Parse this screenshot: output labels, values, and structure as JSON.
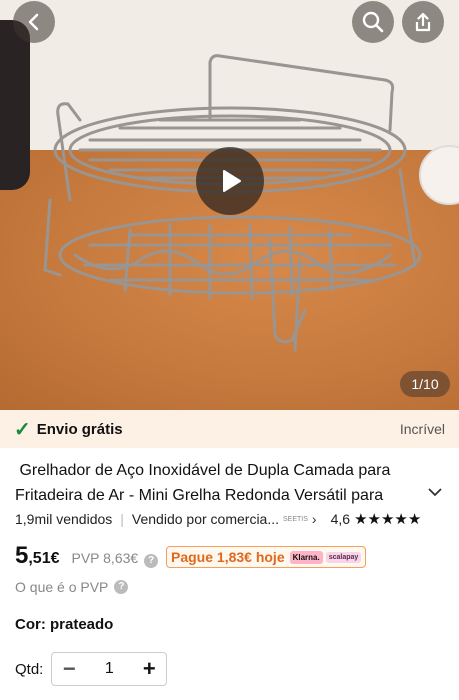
{
  "header": {
    "back_icon": "chevron-left-icon",
    "search_icon": "search-icon",
    "share_icon": "share-icon"
  },
  "gallery": {
    "counter": "1/10",
    "play_icon": "play-icon"
  },
  "shipping": {
    "label": "Envio grátis",
    "badge": "Incrível",
    "color": "#1a8a3c"
  },
  "product": {
    "title": "Grelhador de Aço Inoxidável de Dupla Camada para Fritadeira de Ar - Mini Grelha Redonda Versátil para",
    "sold": "1,9mil vendidos",
    "seller": "Vendido por comercia...",
    "seller_logo": "SEETIS",
    "rating": "4,6",
    "stars": "★★★★★",
    "stars_value": 4.6
  },
  "price": {
    "integer": "5",
    "decimal": ",51€",
    "pvp": "PVP 8,63€",
    "installment": "Pague 1,83€ hoje",
    "klarna": "Klarna.",
    "scalapay": "scalapay",
    "pvp_info": "O que é o PVP",
    "accent": "#e0681a"
  },
  "options": {
    "color_label": "Cor: prateado",
    "qty_label": "Qtd:",
    "qty_value": "1",
    "minus": "−",
    "plus": "+"
  }
}
